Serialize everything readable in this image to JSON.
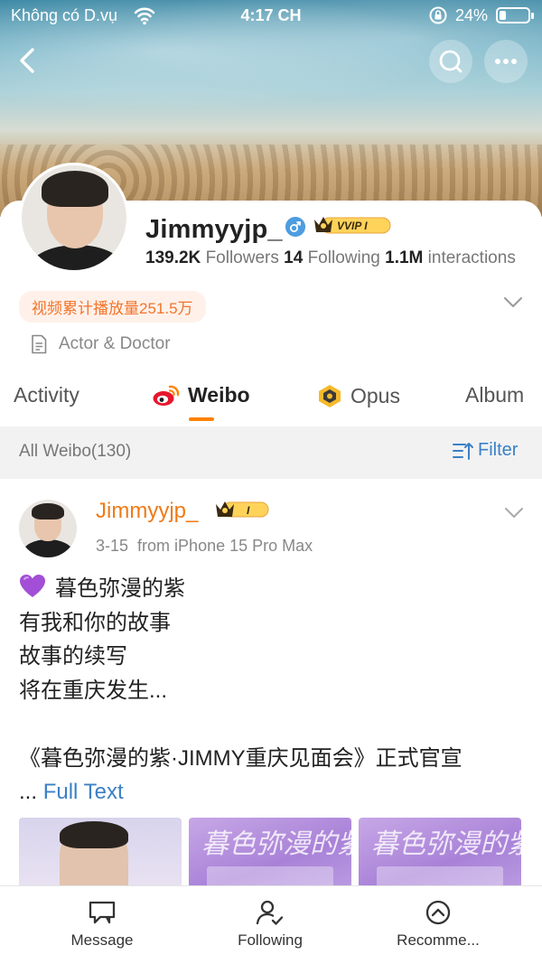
{
  "status_bar": {
    "carrier": "Không có D.vụ",
    "time": "4:17 CH",
    "battery_percent": "24%",
    "battery_level": 0.24
  },
  "header": {
    "back_icon": "chevron-left-icon",
    "search_icon": "search-icon",
    "more_icon": "more-dots-icon"
  },
  "profile": {
    "name": "Jimmyyjp_",
    "vip_badge": "VVIP I",
    "stats": {
      "followers_value": "139.2K",
      "followers_label": "Followers",
      "following_value": "14",
      "following_label": "Following",
      "interactions_value": "1.1M",
      "interactions_label": "interactions"
    },
    "promo_tag": "视频累计播放量251.5万",
    "bio": "Actor & Doctor"
  },
  "tabs": [
    {
      "label": "Activity",
      "active": false
    },
    {
      "label": "Weibo",
      "active": true
    },
    {
      "label": "Opus",
      "active": false
    },
    {
      "label": "Album",
      "active": false
    }
  ],
  "filter_bar": {
    "title": "All Weibo(130)",
    "filter_label": "Filter"
  },
  "post": {
    "author": "Jimmyyjp_",
    "author_vip": "I",
    "date": "3-15",
    "source": "from iPhone 15 Pro Max",
    "lines": [
      "暮色弥漫的紫",
      "有我和你的故事",
      "故事的续写",
      "将在重庆发生...",
      "",
      "《暮色弥漫的紫·JIMMY重庆见面会》正式官宣"
    ],
    "ellipsis": "...",
    "full_text_label": "Full Text",
    "thumb_title": "暮色弥漫的紫"
  },
  "bottom_nav": [
    {
      "label": "Message",
      "icon": "message-icon"
    },
    {
      "label": "Following",
      "icon": "following-icon"
    },
    {
      "label": "Recomme...",
      "icon": "recommend-icon"
    }
  ],
  "colors": {
    "accent_orange": "#ff8200",
    "link_blue": "#3b80c6",
    "author_orange": "#f07a17",
    "promo_text": "#f2742a"
  }
}
